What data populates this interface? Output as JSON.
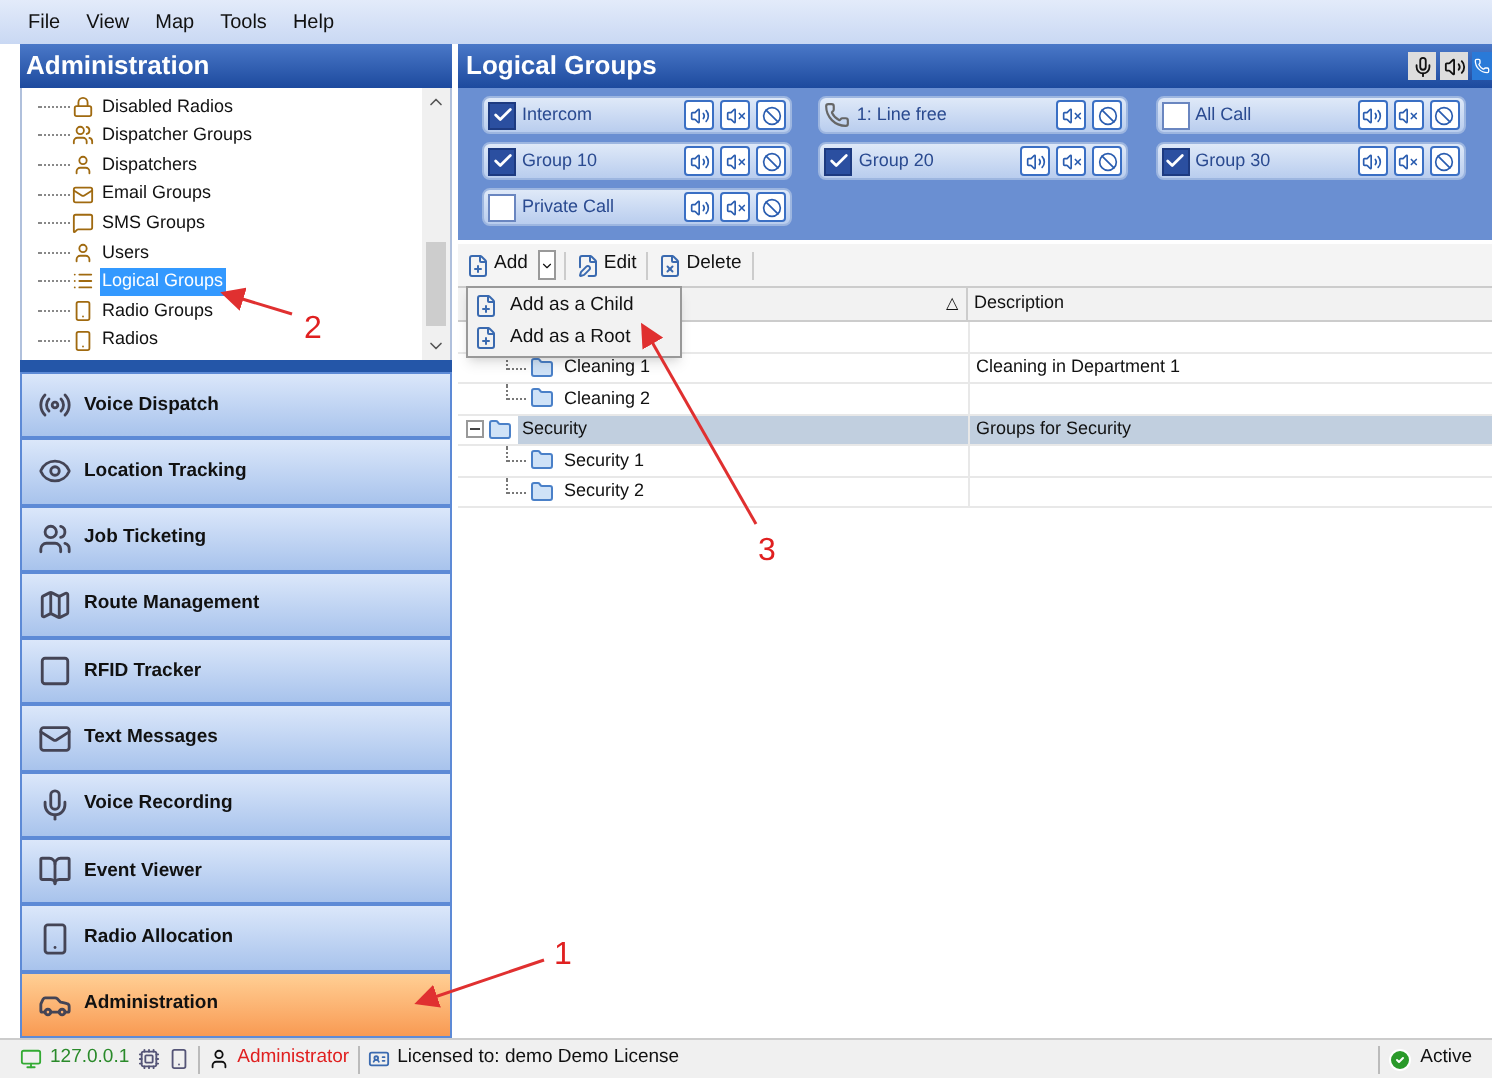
{
  "menu": [
    "File",
    "View",
    "Map",
    "Tools",
    "Help"
  ],
  "sidebar": {
    "title": "Administration",
    "tree": [
      {
        "label": "Disabled Radios",
        "selected": false
      },
      {
        "label": "Dispatcher Groups",
        "selected": false
      },
      {
        "label": "Dispatchers",
        "selected": false
      },
      {
        "label": "Email Groups",
        "selected": false
      },
      {
        "label": "SMS Groups",
        "selected": false
      },
      {
        "label": "Users",
        "selected": false
      },
      {
        "label": "Logical Groups",
        "selected": true
      },
      {
        "label": "Radio Groups",
        "selected": false
      },
      {
        "label": "Radios",
        "selected": false
      }
    ],
    "nav": [
      {
        "label": "Voice Dispatch",
        "selected": false
      },
      {
        "label": "Location Tracking",
        "selected": false
      },
      {
        "label": "Job Ticketing",
        "selected": false
      },
      {
        "label": "Route Management",
        "selected": false
      },
      {
        "label": "RFID Tracker",
        "selected": false
      },
      {
        "label": "Text Messages",
        "selected": false
      },
      {
        "label": "Voice Recording",
        "selected": false
      },
      {
        "label": "Event Viewer",
        "selected": false
      },
      {
        "label": "Radio Allocation",
        "selected": false
      },
      {
        "label": "Administration",
        "selected": true
      }
    ]
  },
  "panel": {
    "title": "Logical Groups",
    "channels": [
      {
        "kind": "group",
        "label": "Intercom",
        "checked": true
      },
      {
        "kind": "line",
        "label": "1: Line free"
      },
      {
        "kind": "group",
        "label": "All Call",
        "checked": false
      },
      {
        "kind": "group",
        "label": "Group 10",
        "checked": true
      },
      {
        "kind": "group",
        "label": "Group 20",
        "checked": true
      },
      {
        "kind": "group",
        "label": "Group 30",
        "checked": true
      },
      {
        "kind": "group",
        "label": "Private Call",
        "checked": false
      }
    ],
    "toolbar": [
      "Add",
      "Edit",
      "Delete"
    ],
    "add_menu": [
      "Add as a Child",
      "Add as a Root"
    ],
    "columns": [
      "Description"
    ],
    "sort_mark": "△",
    "rows": [
      {
        "selected": false,
        "children": [
          {
            "name": "Cleaning 1",
            "description": "Cleaning in Department 1",
            "selected": false
          },
          {
            "name": "Cleaning 2",
            "selected": false
          }
        ]
      },
      {
        "name": "Security",
        "description": "Groups for Security",
        "selected": true,
        "children": [
          {
            "name": "Security 1",
            "selected": false
          },
          {
            "name": "Security 2",
            "selected": false
          }
        ]
      }
    ]
  },
  "status_bar": {
    "address": "127.0.0.1",
    "user": "Administrator",
    "license": "Licensed to: demo Demo License",
    "state": "Active"
  },
  "annotations": [
    "1",
    "2",
    "3"
  ]
}
